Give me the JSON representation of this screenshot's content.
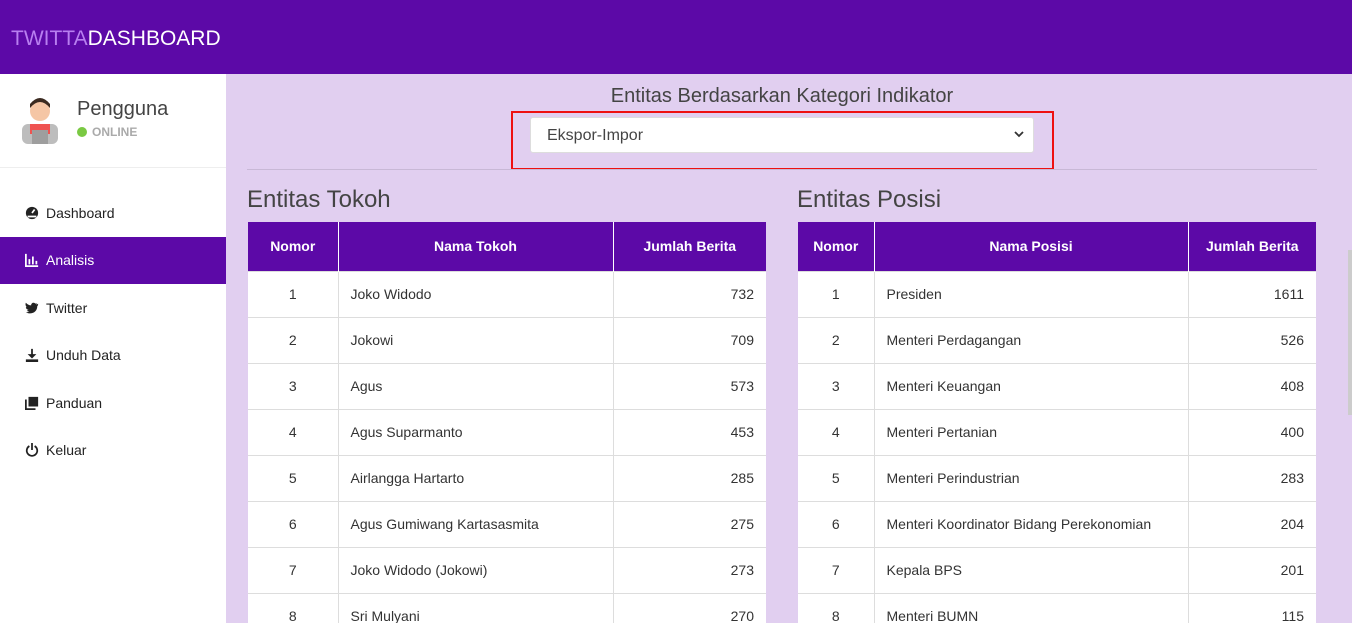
{
  "brand": {
    "part1": "TWITTA",
    "part2": "DASHBOARD"
  },
  "user": {
    "name": "Pengguna",
    "status": "ONLINE"
  },
  "menu": [
    {
      "label": "Dashboard",
      "icon": "dashboard-icon",
      "active": false
    },
    {
      "label": "Analisis",
      "icon": "bar-chart-icon",
      "active": true
    },
    {
      "label": "Twitter",
      "icon": "twitter-icon",
      "active": false
    },
    {
      "label": "Unduh Data",
      "icon": "download-icon",
      "active": false
    },
    {
      "label": "Panduan",
      "icon": "copy-icon",
      "active": false
    },
    {
      "label": "Keluar",
      "icon": "power-icon",
      "active": false
    }
  ],
  "main": {
    "section_title": "Entitas Berdasarkan Kategori Indikator",
    "select_value": "Ekspor-Impor"
  },
  "tokoh": {
    "title": "Entitas Tokoh",
    "headers": [
      "Nomor",
      "Nama Tokoh",
      "Jumlah Berita"
    ],
    "rows": [
      [
        "1",
        "Joko Widodo",
        "732"
      ],
      [
        "2",
        "Jokowi",
        "709"
      ],
      [
        "3",
        "Agus",
        "573"
      ],
      [
        "4",
        "Agus Suparmanto",
        "453"
      ],
      [
        "5",
        "Airlangga Hartarto",
        "285"
      ],
      [
        "6",
        "Agus Gumiwang Kartasasmita",
        "275"
      ],
      [
        "7",
        "Joko Widodo (Jokowi)",
        "273"
      ],
      [
        "8",
        "Sri Mulyani",
        "270"
      ]
    ]
  },
  "posisi": {
    "title": "Entitas Posisi",
    "headers": [
      "Nomor",
      "Nama Posisi",
      "Jumlah Berita"
    ],
    "rows": [
      [
        "1",
        "Presiden",
        "1611"
      ],
      [
        "2",
        "Menteri Perdagangan",
        "526"
      ],
      [
        "3",
        "Menteri Keuangan",
        "408"
      ],
      [
        "4",
        "Menteri Pertanian",
        "400"
      ],
      [
        "5",
        "Menteri Perindustrian",
        "283"
      ],
      [
        "6",
        "Menteri Koordinator Bidang Perekonomian",
        "204"
      ],
      [
        "7",
        "Kepala BPS",
        "201"
      ],
      [
        "8",
        "Menteri BUMN",
        "115"
      ]
    ]
  },
  "colors": {
    "primary": "#5c09a7",
    "accent": "#b87ff0",
    "background": "#e1cff0",
    "highlight": "#ee1111",
    "online": "#7ac943"
  }
}
